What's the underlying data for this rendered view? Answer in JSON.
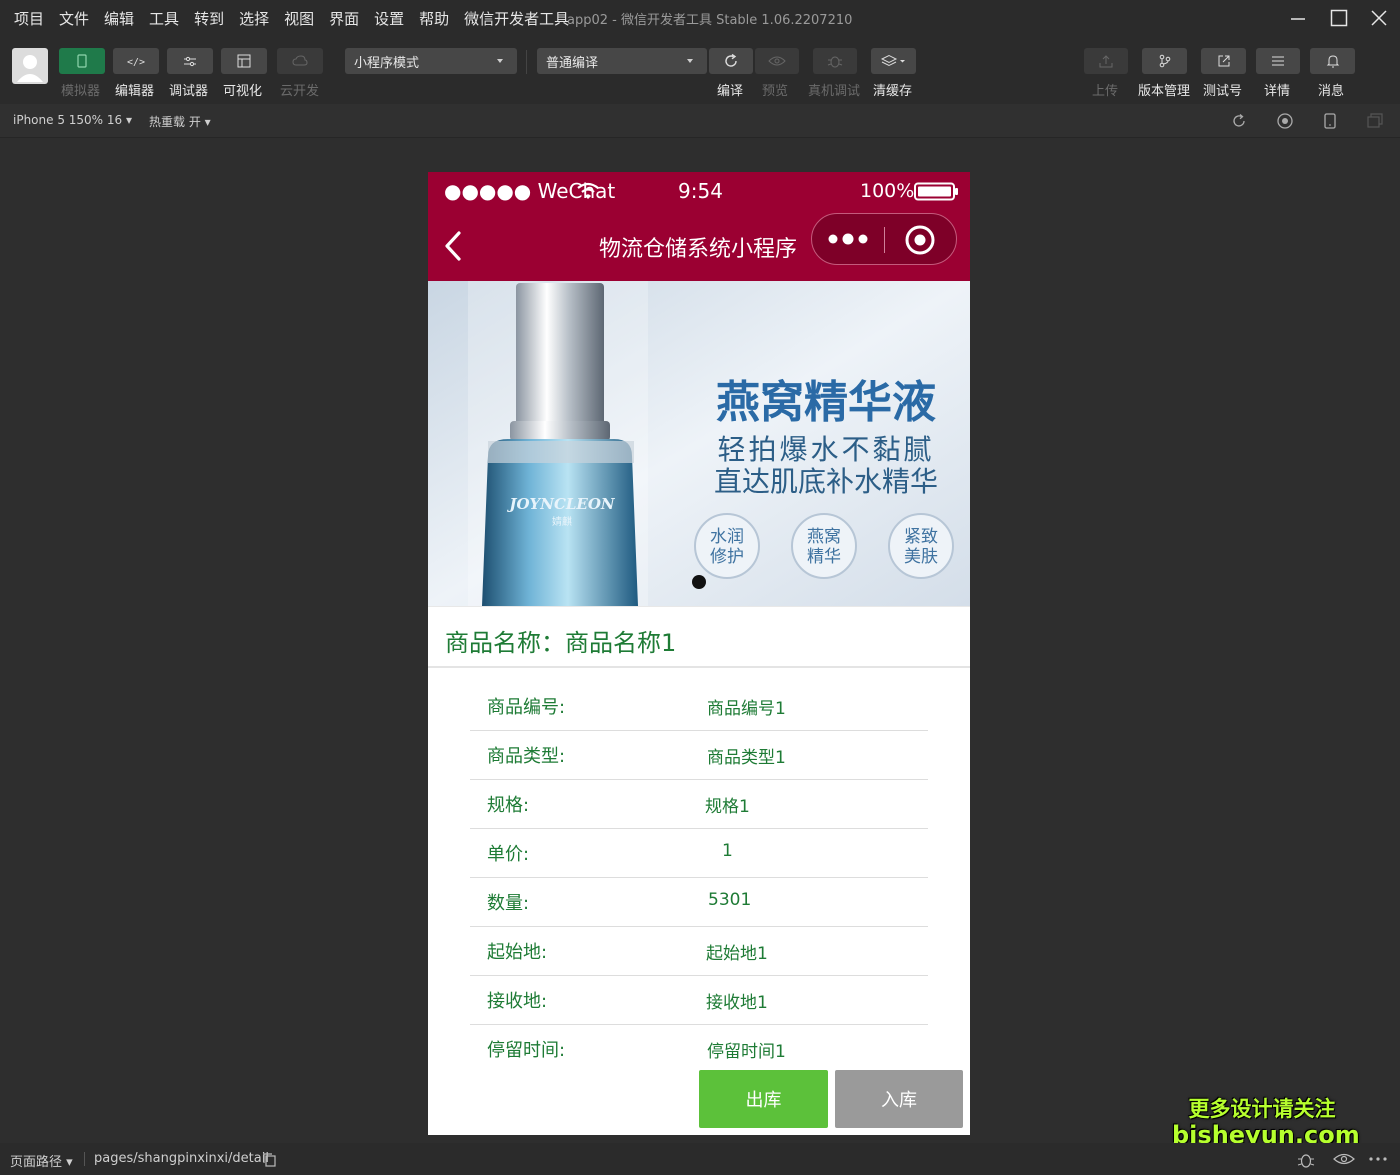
{
  "menubar": {
    "items": [
      "项目",
      "文件",
      "编辑",
      "工具",
      "转到",
      "选择",
      "视图",
      "界面",
      "设置",
      "帮助",
      "微信开发者工具"
    ],
    "window_title": "app02 - 微信开发者工具 Stable 1.06.2207210"
  },
  "toolbar": {
    "simulator_label": "模拟器",
    "editor_label": "编辑器",
    "debugger_label": "调试器",
    "visual_label": "可视化",
    "cloud_label": "云开发",
    "mode_select": "小程序模式",
    "compile_select": "普通编译",
    "compile_label": "编译",
    "preview_label": "预览",
    "remote_debug_label": "真机调试",
    "clear_cache_label": "清缓存",
    "upload_label": "上传",
    "version_label": "版本管理",
    "test_label": "测试号",
    "details_label": "详情",
    "messages_label": "消息"
  },
  "subbar": {
    "device": "iPhone 5 150% 16",
    "hot_reload": "热重载 开"
  },
  "phone": {
    "carrier": "●●●●● WeChat",
    "time": "9:54",
    "battery": "100%",
    "nav_title": "物流仓储系统小程序",
    "banner": {
      "headline": "燕窝精华液",
      "line1": "轻拍爆水不黏腻",
      "line2": "直达肌底补水精华",
      "badges": [
        {
          "top": "水润",
          "bottom": "修护"
        },
        {
          "top": "燕窝",
          "bottom": "精华"
        },
        {
          "top": "紧致",
          "bottom": "美肤"
        }
      ],
      "brand": "JOYNCLEON",
      "brand_cn": "婧麒"
    },
    "product_title": "商品名称：商品名称1",
    "details": [
      {
        "label": "商品编号:",
        "value": "商品编号1"
      },
      {
        "label": "商品类型:",
        "value": "商品类型1"
      },
      {
        "label": "规格:",
        "value": "规格1"
      },
      {
        "label": "单价:",
        "value": "1"
      },
      {
        "label": "数量:",
        "value": "5301"
      },
      {
        "label": "起始地:",
        "value": "起始地1"
      },
      {
        "label": "接收地:",
        "value": "接收地1"
      },
      {
        "label": "停留时间:",
        "value": "停留时间1"
      }
    ],
    "out_button": "出库",
    "in_button": "入库"
  },
  "bottombar": {
    "path_label": "页面路径",
    "path": "pages/shangpinxinxi/detail"
  },
  "watermark": {
    "line1": "更多设计请关注",
    "line2": "bisheyun.com"
  },
  "colors": {
    "nav_bg": "#9b0032",
    "text_green": "#1e7b35",
    "out_button": "#5cc13a",
    "in_button": "#9a9a9a"
  }
}
